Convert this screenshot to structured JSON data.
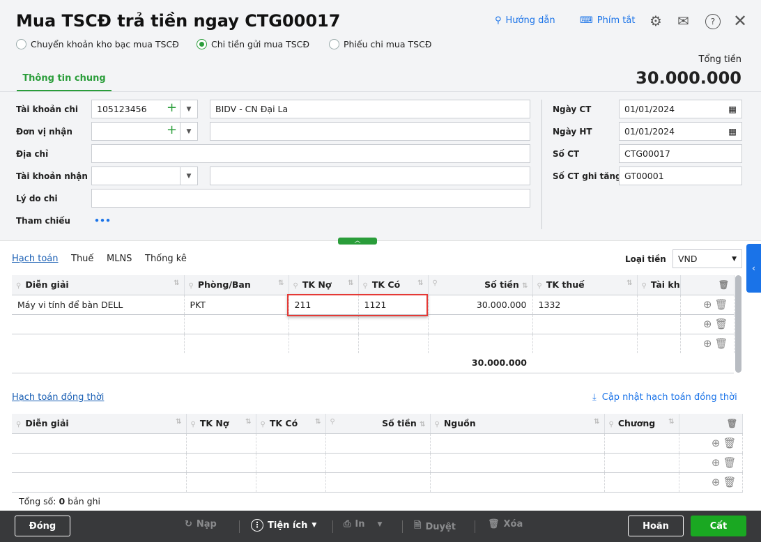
{
  "title": "Mua TSCĐ trả tiền ngay CTG00017",
  "toolbar": {
    "guide": "Hướng dẫn",
    "shortcut": "Phím tắt"
  },
  "payment_types": [
    {
      "label": "Chuyển khoản kho bạc mua TSCĐ",
      "selected": false
    },
    {
      "label": "Chi tiền gửi mua TSCĐ",
      "selected": true
    },
    {
      "label": "Phiếu chi mua TSCĐ",
      "selected": false
    }
  ],
  "total": {
    "label": "Tổng tiền",
    "value": "30.000.000"
  },
  "tab_general": "Thông tin chung",
  "form": {
    "account_label": "Tài khoản chi",
    "account_value": "105123456",
    "bank_value": "BIDV - CN Đại La",
    "recipient_label": "Đơn vị nhận",
    "recipient_value": "",
    "recipient_name": "",
    "address_label": "Địa chỉ",
    "address_value": "",
    "recv_account_label": "Tài khoản nhận",
    "recv_account_value": "",
    "recv_bank": "",
    "reason_label": "Lý do chi",
    "reason_value": "",
    "ref_label": "Tham chiếu",
    "ref_value": "•••",
    "date_ct_label": "Ngày CT",
    "date_ct": "01/01/2024",
    "date_ht_label": "Ngày HT",
    "date_ht": "01/01/2024",
    "so_ct_label": "Số CT",
    "so_ct": "CTG00017",
    "so_ct_gt_label": "Số CT ghi tăng",
    "so_ct_gt": "GT00001"
  },
  "detail_tabs": [
    "Hạch toán",
    "Thuế",
    "MLNS",
    "Thống kê"
  ],
  "currency": {
    "label": "Loại tiền",
    "value": "VND"
  },
  "grid1": {
    "columns": [
      "Diễn giải",
      "Phòng/Ban",
      "TK Nợ",
      "TK Có",
      "Số tiền",
      "TK thuế",
      "Tài kh"
    ],
    "rows": [
      [
        "Máy vi tính để bàn DELL",
        "PKT",
        "211",
        "1121",
        "30.000.000",
        "1332",
        ""
      ]
    ],
    "total": "30.000.000"
  },
  "concurrent": {
    "title": "Hạch toán đồng thời",
    "update": "Cập nhật hạch toán đồng thời"
  },
  "grid2": {
    "columns": [
      "Diễn giải",
      "TK Nợ",
      "TK Có",
      "Số tiền",
      "Nguồn",
      "Chương"
    ]
  },
  "record_count": {
    "prefix": "Tổng số: ",
    "count": "0",
    "suffix": " bản ghi"
  },
  "footer": {
    "close": "Đóng",
    "reload": "Nạp",
    "utilities": "Tiện ích",
    "print": "In",
    "approve": "Duyệt",
    "delete": "Xóa",
    "cancel": "Hoãn",
    "save": "Cất"
  },
  "colors": {
    "accent": "#2a9d3a",
    "link": "#1a73e8",
    "highlight": "#e53935"
  }
}
